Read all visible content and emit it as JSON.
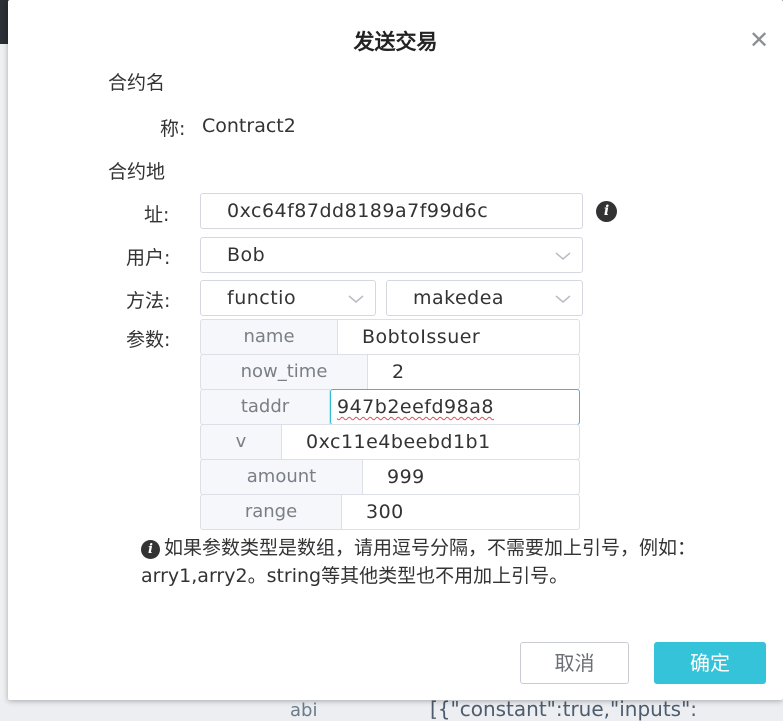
{
  "dialog": {
    "title": "发送交易",
    "close_icon": "close-icon"
  },
  "contract_name": {
    "label_line1": "合约名",
    "label_line2": "称:",
    "value": "Contract2"
  },
  "contract_address": {
    "label_line1": "合约地",
    "label_line2": "址:",
    "value": "0xc64f87dd8189a7f99d6c",
    "info_icon": "info-circle-icon"
  },
  "user": {
    "label": "用户:",
    "value": "Bob"
  },
  "method": {
    "label": "方法:",
    "type_value": "functio",
    "name_value": "makedea"
  },
  "params": {
    "label": "参数:",
    "rows": [
      {
        "key": "name",
        "value": "BobtoIssuer"
      },
      {
        "key": "now_time",
        "value": "2"
      },
      {
        "key": "taddr",
        "value": "947b2eefd98a8"
      },
      {
        "key": "v",
        "value": "0xc11e4beebd1b1"
      },
      {
        "key": "amount",
        "value": "999"
      },
      {
        "key": "range",
        "value": "300"
      }
    ]
  },
  "hint": {
    "text": "如果参数类型是数组，请用逗号分隔，不需要加上引号，例如：arry1,arry2。string等其他类型也不用加上引号。"
  },
  "buttons": {
    "cancel": "取消",
    "ok": "确定"
  },
  "background": {
    "bottom_left": "abi",
    "bottom_code": "[{\"constant\":true,\"inputs\":"
  },
  "colors": {
    "accent": "#34c3d8",
    "overlay": "#7c7f86"
  }
}
